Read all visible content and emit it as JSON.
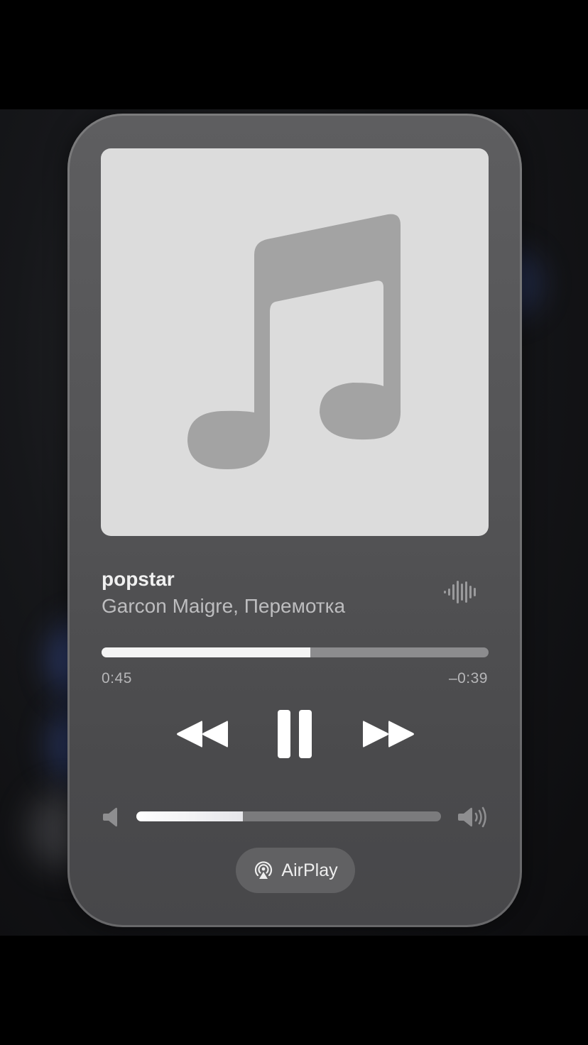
{
  "now_playing": {
    "title": "popstar",
    "artist": "Garcon Maigre, Перемотка",
    "artwork_icon": "music-note-icon",
    "waveform_icon": "waveform-icon"
  },
  "progress": {
    "elapsed": "0:45",
    "remaining": "–0:39",
    "fraction": 0.54
  },
  "controls": {
    "rewind_icon": "rewind-icon",
    "pause_icon": "pause-icon",
    "forward_icon": "fast-forward-icon"
  },
  "volume": {
    "level": 0.35,
    "low_icon": "speaker-low-icon",
    "high_icon": "speaker-high-icon"
  },
  "airplay": {
    "label": "AirPlay",
    "icon": "airplay-icon"
  },
  "colors": {
    "card": "#555557",
    "artwork_bg": "#dcdcdc",
    "note": "#a3a3a3",
    "progress_fill": "#f4f4f4",
    "progress_track": "#8c8c8e"
  }
}
